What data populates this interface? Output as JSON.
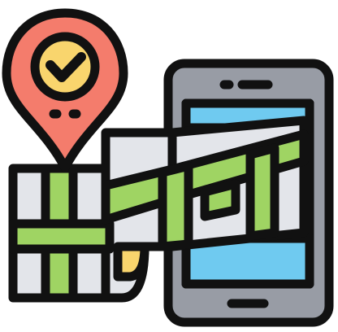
{
  "icon": {
    "name": "map-navigation-icon",
    "parts": [
      "location-pin-icon",
      "checkmark-icon",
      "folded-map-icon",
      "smartphone-icon",
      "route-lines"
    ]
  },
  "colors": {
    "outline": "#111111",
    "pin": "#f47c6c",
    "pin_circle": "#f9d56d",
    "map_paper": "#e3e5ea",
    "route": "#9fd463",
    "phone_body": "#989ca5",
    "phone_screen_top": "#6fcaf0",
    "phone_screen_mid": "#e3e5ea",
    "map_shadow": "#f9d56d"
  }
}
